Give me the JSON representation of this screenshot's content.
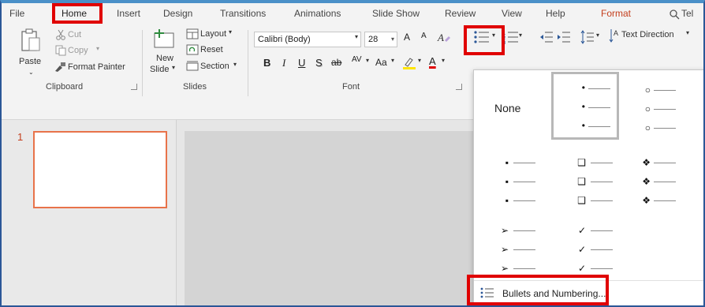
{
  "menu": {
    "tabs": [
      "File",
      "Home",
      "Insert",
      "Design",
      "Transitions",
      "Animations",
      "Slide Show",
      "Review",
      "View",
      "Help",
      "Format",
      "Tel"
    ]
  },
  "ribbon": {
    "clipboard": {
      "paste": "Paste",
      "cut": "Cut",
      "copy": "Copy",
      "format_painter": "Format Painter",
      "label": "Clipboard"
    },
    "slides": {
      "new_slide_line1": "New",
      "new_slide_line2": "Slide",
      "layout": "Layout",
      "reset": "Reset",
      "section": "Section",
      "label": "Slides"
    },
    "font": {
      "name": "Calibri (Body)",
      "size": "28",
      "grow": "A",
      "shrink": "A",
      "bold": "B",
      "italic": "I",
      "underline": "U",
      "shadow": "S",
      "strike": "ab",
      "spacing": "AV",
      "case": "Aa",
      "color": "A",
      "label": "Font"
    },
    "paragraph": {
      "text_direction": "Text Direction"
    }
  },
  "slides_panel": {
    "slide_number": "1"
  },
  "bullets_dropdown": {
    "none_label": "None",
    "rows": [
      [
        {
          "name": "none"
        },
        {
          "name": "small-dot",
          "glyph": "•",
          "selected": true
        },
        {
          "name": "hollow-circle",
          "glyph": "○"
        }
      ],
      [
        {
          "name": "filled-square",
          "glyph": "▪"
        },
        {
          "name": "hollow-square",
          "glyph": "❑"
        },
        {
          "name": "diamond-4",
          "glyph": "❖"
        }
      ],
      [
        {
          "name": "arrow",
          "glyph": "➢"
        },
        {
          "name": "checkmark",
          "glyph": "✓"
        }
      ]
    ],
    "footer_label": "Bullets and Numbering..."
  },
  "colors": {
    "accent": "#c43e1c",
    "highlight": "#e00000",
    "thumb_border": "#e8734a"
  }
}
